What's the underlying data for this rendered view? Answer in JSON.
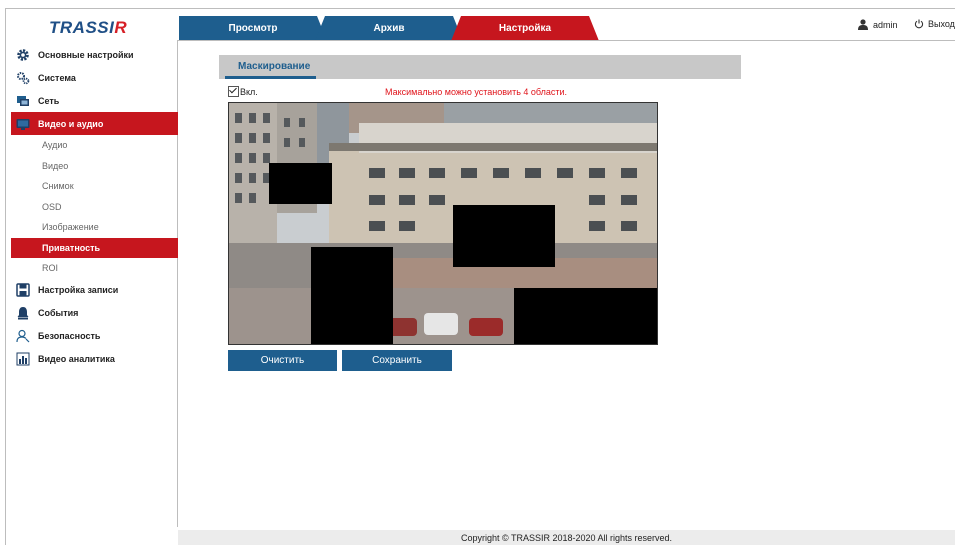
{
  "header": {
    "logo_text": "TRASSIR",
    "tabs": [
      {
        "label": "Просмотр"
      },
      {
        "label": "Архив"
      },
      {
        "label": "Настройка"
      }
    ],
    "user_name": "admin",
    "logout_label": "Выход"
  },
  "sidebar": {
    "items": [
      {
        "label": "Основные настройки",
        "icon": "gear-icon"
      },
      {
        "label": "Система",
        "icon": "gears-icon"
      },
      {
        "label": "Сеть",
        "icon": "network-icon"
      },
      {
        "label": "Видео и аудио",
        "icon": "monitor-icon"
      },
      {
        "label": "Настройка записи",
        "icon": "save-icon"
      },
      {
        "label": "События",
        "icon": "alarm-icon"
      },
      {
        "label": "Безопасность",
        "icon": "user-security-icon"
      },
      {
        "label": "Видео аналитика",
        "icon": "analytics-icon"
      }
    ],
    "subitems": [
      "Аудио",
      "Видео",
      "Снимок",
      "OSD",
      "Изображение",
      "Приватность",
      "ROI"
    ]
  },
  "main": {
    "section_title": "Маскирование",
    "enable_label": "Вкл.",
    "enable_checked": true,
    "warning_text": "Максимально можно установить 4 области.",
    "clear_button": "Очистить",
    "save_button": "Сохранить"
  },
  "footer": {
    "copyright": "Copyright © TRASSIR 2018-2020 All rights reserved."
  },
  "colors": {
    "brand_blue": "#1e5e8e",
    "brand_red": "#c6161e",
    "warning_red": "#e0141b"
  }
}
